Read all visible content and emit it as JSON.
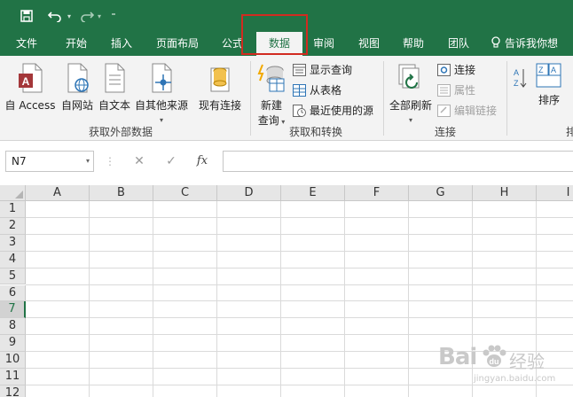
{
  "quick_access": {
    "icons": [
      "save-icon",
      "undo-icon",
      "redo-icon",
      "customize-icon"
    ],
    "customize_glyph": "⁼"
  },
  "tabs": [
    {
      "label": "文件"
    },
    {
      "label": "开始"
    },
    {
      "label": "插入"
    },
    {
      "label": "页面布局"
    },
    {
      "label": "公式"
    },
    {
      "label": "数据",
      "active": true
    },
    {
      "label": "审阅"
    },
    {
      "label": "视图"
    },
    {
      "label": "帮助"
    },
    {
      "label": "团队"
    }
  ],
  "tell_me": "告诉我你想",
  "ribbon": {
    "get_external": {
      "label": "获取外部数据",
      "buttons": [
        {
          "label": "自 Access",
          "icon": "access-file-icon"
        },
        {
          "label": "自网站",
          "icon": "web-file-icon"
        },
        {
          "label": "自文本",
          "icon": "text-file-icon"
        },
        {
          "label": "自其他来源",
          "icon": "other-sources-icon"
        },
        {
          "label": "现有连接",
          "icon": "existing-connections-icon"
        }
      ]
    },
    "get_transform": {
      "label": "获取和转换",
      "new_query_line1": "新建",
      "new_query_line2": "查询",
      "small": [
        {
          "label": "显示查询",
          "icon": "show-queries-icon"
        },
        {
          "label": "从表格",
          "icon": "from-table-icon"
        },
        {
          "label": "最近使用的源",
          "icon": "recent-sources-icon"
        }
      ]
    },
    "connections": {
      "label": "连接",
      "refresh_all": "全部刷新",
      "small": [
        {
          "label": "连接",
          "icon": "connections-icon",
          "disabled": false
        },
        {
          "label": "属性",
          "icon": "properties-icon",
          "disabled": true
        },
        {
          "label": "编辑链接",
          "icon": "edit-links-icon",
          "disabled": true
        }
      ]
    },
    "sort": {
      "label": "排序",
      "group_label_partial": "排"
    }
  },
  "formula_bar": {
    "name_box": "N7",
    "cancel": "✕",
    "enter": "✓",
    "fx": "fx",
    "value": ""
  },
  "sheet": {
    "columns": [
      "A",
      "B",
      "C",
      "D",
      "E",
      "F",
      "G",
      "H",
      "I"
    ],
    "rows": [
      "1",
      "2",
      "3",
      "4",
      "5",
      "6",
      "7",
      "8",
      "9",
      "10",
      "11",
      "12"
    ],
    "active_row": "7",
    "active_cell": "N7"
  },
  "watermark": {
    "brand": "Bai",
    "cn": "经验",
    "url": "jingyan.baidu.com"
  },
  "colors": {
    "excel_green": "#217346",
    "highlight_red": "#d12b20",
    "ribbon_bg": "#f3f3f3"
  }
}
